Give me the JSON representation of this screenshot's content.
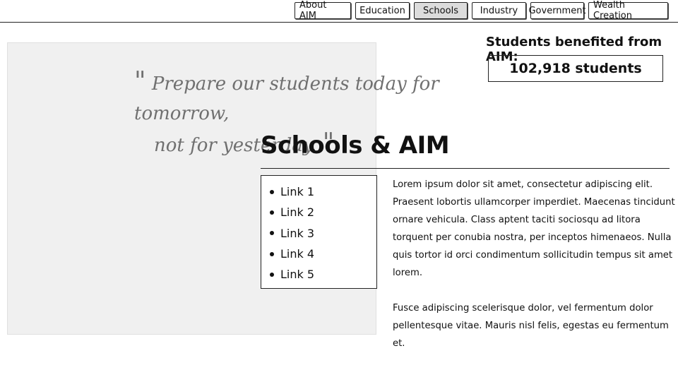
{
  "nav": {
    "tabs": [
      {
        "label": "About AIM"
      },
      {
        "label": "Education"
      },
      {
        "label": "Schools",
        "active": true
      },
      {
        "label": "Industry"
      },
      {
        "label": "Government"
      },
      {
        "label": "Wealth Creation"
      }
    ]
  },
  "hero": {
    "quote_line1": "Prepare our students today for tomorrow,",
    "quote_line2": "not for yesterday.",
    "open_mark": "\"",
    "close_mark": "\""
  },
  "stats": {
    "title": "Students benefited from AIM:",
    "value": "102,918 students"
  },
  "section": {
    "title": "Schools & AIM",
    "links": [
      {
        "label": "Link 1"
      },
      {
        "label": "Link 2"
      },
      {
        "label": "Link 3"
      },
      {
        "label": "Link 4"
      },
      {
        "label": "Link 5"
      }
    ],
    "paragraph1": "Lorem ipsum dolor sit amet, consectetur adipiscing elit. Praesent lobortis ullamcorper imperdiet. Maecenas tincidunt ornare vehicula. Class aptent taciti sociosqu ad litora torquent per conubia nostra, per inceptos himenaeos. Nulla quis tortor id orci condimentum sollicitudin tempus sit amet lorem.",
    "paragraph2": "Fusce adipiscing scelerisque dolor, vel fermentum dolor pellentesque vitae. Mauris nisl felis, egestas eu fermentum et."
  },
  "colors": {
    "active_tab": "#dcdcdc",
    "hero_bg": "#f0f0f0",
    "quote_text": "#707070"
  }
}
